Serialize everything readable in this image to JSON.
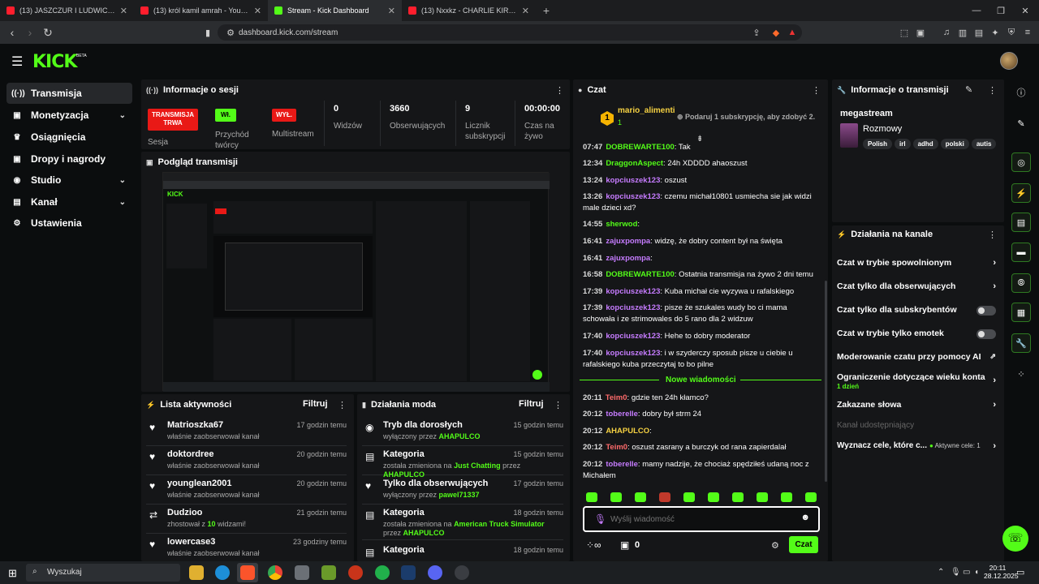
{
  "browser": {
    "tabs": [
      {
        "title": "(13) JASZCZUR I LUDWICZEK O UKRA",
        "color": "#ff1e2d",
        "active": false
      },
      {
        "title": "(13) król kamil amrah - YouTube",
        "color": "#ff1e2d",
        "active": false
      },
      {
        "title": "Stream - Kick Dashboard",
        "color": "#53fc18",
        "active": true
      },
      {
        "title": "(13) Nxxkz - CHARLIE KIRK FUNK",
        "color": "#ff1e2d",
        "active": false
      }
    ],
    "url": "dashboard.kick.com/stream"
  },
  "app": {
    "logo": "KICK",
    "beta": "BETA"
  },
  "sidebar": {
    "items": [
      {
        "label": "Transmisja",
        "icon": "broadcast-icon",
        "glyph": "((·))",
        "chevron": false,
        "active": true
      },
      {
        "label": "Monetyzacja",
        "icon": "wallet-icon",
        "glyph": "▣",
        "chevron": true,
        "active": false
      },
      {
        "label": "Osiągnięcia",
        "icon": "trophy-icon",
        "glyph": "🏆",
        "chevron": false,
        "active": false
      },
      {
        "label": "Dropy i nagrody",
        "icon": "gift-icon",
        "glyph": "▣",
        "chevron": false,
        "active": false
      },
      {
        "label": "Studio",
        "icon": "studio-icon",
        "glyph": "◉",
        "chevron": true,
        "active": false
      },
      {
        "label": "Kanał",
        "icon": "channel-icon",
        "glyph": "▤",
        "chevron": true,
        "active": false
      },
      {
        "label": "Ustawienia",
        "icon": "settings-icon",
        "glyph": "⚙",
        "chevron": false,
        "active": false
      }
    ]
  },
  "session": {
    "title": "Informacje o sesji",
    "stream_badge": "TRANSMISJA TRWA",
    "stream_label": "Sesja",
    "on_badge": "Wł.",
    "on_label": "Przychód twórcy",
    "off_badge": "WYŁ.",
    "off_label": "Multistream",
    "stats": [
      {
        "value": "0",
        "label": "Widzów"
      },
      {
        "value": "3660",
        "label": "Obserwujących"
      },
      {
        "value": "9",
        "label": "Licznik subskrypcji"
      },
      {
        "value": "00:00:00",
        "label": "Czas na żywo"
      }
    ]
  },
  "preview": {
    "title": "Podgląd transmisji"
  },
  "activity": {
    "title": "Lista aktywności",
    "filter": "Filtruj",
    "rows": [
      {
        "name": "Matrioszka67",
        "sub": "właśnie zaobserwował kanał",
        "time": "17 godzin temu",
        "icon": "heart-icon"
      },
      {
        "name": "doktordree",
        "sub": "właśnie zaobserwował kanał",
        "time": "20 godzin temu",
        "icon": "heart-icon"
      },
      {
        "name": "younglean2001",
        "sub": "właśnie zaobserwował kanał",
        "time": "20 godzin temu",
        "icon": "heart-icon"
      },
      {
        "name": "Dudzioo",
        "sub_prefix": "zhostował z ",
        "sub_num": "10",
        "sub_suffix": " widzami!",
        "time": "21 godzin temu",
        "icon": "host-icon"
      },
      {
        "name": "lowercase3",
        "sub": "właśnie zaobserwował kanał",
        "time": "23 godziny temu",
        "icon": "heart-icon"
      }
    ]
  },
  "modactions": {
    "title": "Działania moda",
    "filter": "Filtruj",
    "rows": [
      {
        "name": "Tryb dla dorosłych",
        "sub": "wyłączony przez ",
        "user": "AHAPULCO",
        "time": "15 godzin temu",
        "icon": "eye-icon"
      },
      {
        "name": "Kategoria",
        "sub": "została zmieniona na ",
        "cat": "Just Chatting",
        "sub2": " przez ",
        "user": "AHAPULCO",
        "time": "15 godzin temu",
        "icon": "category-icon"
      },
      {
        "name": "Tylko dla obserwujących",
        "sub": "wyłączony przez ",
        "user": "pawel71337",
        "time": "17 godzin temu",
        "icon": "heart-icon"
      },
      {
        "name": "Kategoria",
        "sub": "została zmieniona na ",
        "cat": "American Truck Simulator",
        "sub2": " przez ",
        "user": "AHAPULCO",
        "time": "18 godzin temu",
        "icon": "category-icon"
      },
      {
        "name": "Kategoria",
        "sub": "",
        "user": "",
        "time": "18 godzin temu",
        "icon": "category-icon"
      }
    ]
  },
  "chat": {
    "title": "Czat",
    "pinned_user": "mario_alimenti",
    "pinned_badge": "1",
    "pinned_count": "1",
    "promo": "Podaruj 1 subskrypcję, aby zdobyć 2.",
    "messages": [
      {
        "time": "07:47",
        "user": "DOBREWARTE100",
        "color": "#53fc18",
        "text": "Tak"
      },
      {
        "time": "12:34",
        "user": "DraggonAspect",
        "color": "#53fc18",
        "text": "24h XDDDD ahaoszust"
      },
      {
        "time": "13:24",
        "user": "kopciuszek123",
        "color": "#c67cff",
        "text": "oszust"
      },
      {
        "time": "13:26",
        "user": "kopciuszek123",
        "color": "#c67cff",
        "text": "czemu michał10801 usmiecha sie jak widzi male dzieci xd?"
      },
      {
        "time": "14:55",
        "user": "sherwod",
        "color": "#53fc18",
        "text": ""
      },
      {
        "time": "16:41",
        "user": "zajuxpompa",
        "color": "#c67cff",
        "text": "widzę, że dobry content był na święta"
      },
      {
        "time": "16:41",
        "user": "zajuxpompa",
        "color": "#c67cff",
        "text": ""
      },
      {
        "time": "16:58",
        "user": "DOBREWARTE100",
        "color": "#53fc18",
        "text": "Ostatnia transmisja na żywo 2 dni temu"
      },
      {
        "time": "17:39",
        "user": "kopciuszek123",
        "color": "#c67cff",
        "text": "Kuba michał cie wyzywa u rafalskiego"
      },
      {
        "time": "17:39",
        "user": "kopciuszek123",
        "color": "#c67cff",
        "text": "pisze że szukales wudy bo ci mama schowała i ze strimowales do 5 rano dla 2 widzuw"
      },
      {
        "time": "17:40",
        "user": "kopciuszek123",
        "color": "#c67cff",
        "text": "Hehe to dobry moderator"
      },
      {
        "time": "17:40",
        "user": "kopciuszek123",
        "color": "#c67cff",
        "text": "i w szyderczy sposub pisze u ciebie u rafalskiego kuba przeczytaj to bo pilne"
      }
    ],
    "new_messages": "Nowe wiadomości",
    "new": [
      {
        "time": "20:11",
        "user": "Teim0",
        "color": "#ff6b6b",
        "text": "gdzie ten 24h kłamco?"
      },
      {
        "time": "20:12",
        "user": "toberelle",
        "color": "#c67cff",
        "text": "dobry był strm 24"
      },
      {
        "time": "20:12",
        "user": "AHAPULCO",
        "color": "#f5d142",
        "text": ""
      },
      {
        "time": "20:12",
        "user": "Teim0",
        "color": "#ff6b6b",
        "text": "oszust zasrany a burczyk od rana zapierdalał"
      },
      {
        "time": "20:12",
        "user": "toberelle",
        "color": "#c67cff",
        "text": "mamy nadzije, że chociaż spędziłeś udaną noc z Michałem"
      }
    ],
    "placeholder": "Wyślij wiadomość",
    "count": "0",
    "send": "Czat"
  },
  "info": {
    "title": "Informacje o transmisji",
    "stream_title": "megastream",
    "category": "Rozmowy",
    "tags": [
      "Polish",
      "irl",
      "adhd",
      "polski",
      "autis"
    ]
  },
  "channel_ops": {
    "title": "Działania na kanale",
    "rows": [
      {
        "label": "Czat w trybie spowolnionym",
        "type": "arrow"
      },
      {
        "label": "Czat tylko dla obserwujących",
        "type": "arrow"
      },
      {
        "label": "Czat tylko dla subskrybentów",
        "type": "toggle"
      },
      {
        "label": "Czat w trybie tylko emotek",
        "type": "toggle"
      },
      {
        "label": "Moderowanie czatu przy pomocy AI",
        "type": "external"
      },
      {
        "label": "Ograniczenie dotyczące wieku konta",
        "sub": "1 dzień",
        "type": "arrow"
      },
      {
        "label": "Zakazane słowa",
        "type": "arrow"
      },
      {
        "label": "Kanał udostępniający",
        "type": "disabled"
      },
      {
        "label": "Wyznacz cele, które c...",
        "extra": "Aktywne cele: 1",
        "type": "arrow"
      }
    ]
  },
  "taskbar": {
    "search": "Wyszukaj",
    "time": "20:11",
    "date": "28.12.2025"
  },
  "colors": {
    "accent": "#53fc18",
    "live": "#e91916",
    "panel": "#151618",
    "bg": "#0b0d0e"
  }
}
